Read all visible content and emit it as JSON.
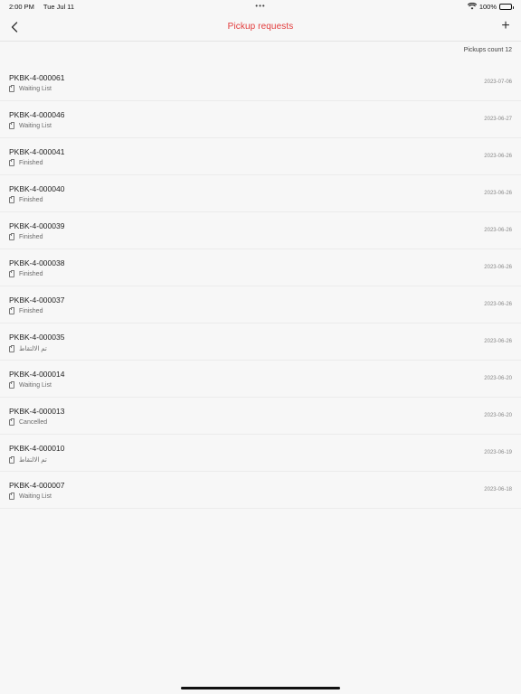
{
  "status_bar": {
    "time": "2:00 PM",
    "date": "Tue Jul 11",
    "dots": "•••",
    "battery": "100%"
  },
  "nav": {
    "title": "Pickup requests",
    "add": "+"
  },
  "count": {
    "label": "Pickups count 12"
  },
  "pickups": [
    {
      "id": "PKBK-4-000061",
      "status": "Waiting List",
      "date": "2023-07-06"
    },
    {
      "id": "PKBK-4-000046",
      "status": "Waiting List",
      "date": "2023-06-27"
    },
    {
      "id": "PKBK-4-000041",
      "status": "Finished",
      "date": "2023-06-26"
    },
    {
      "id": "PKBK-4-000040",
      "status": "Finished",
      "date": "2023-06-26"
    },
    {
      "id": "PKBK-4-000039",
      "status": "Finished",
      "date": "2023-06-26"
    },
    {
      "id": "PKBK-4-000038",
      "status": "Finished",
      "date": "2023-06-26"
    },
    {
      "id": "PKBK-4-000037",
      "status": "Finished",
      "date": "2023-06-26"
    },
    {
      "id": "PKBK-4-000035",
      "status": "تم الالتقاط",
      "date": "2023-06-26"
    },
    {
      "id": "PKBK-4-000014",
      "status": "Waiting List",
      "date": "2023-06-20"
    },
    {
      "id": "PKBK-4-000013",
      "status": "Cancelled",
      "date": "2023-06-20"
    },
    {
      "id": "PKBK-4-000010",
      "status": "تم الالتقاط",
      "date": "2023-06-19"
    },
    {
      "id": "PKBK-4-000007",
      "status": "Waiting List",
      "date": "2023-06-18"
    }
  ]
}
